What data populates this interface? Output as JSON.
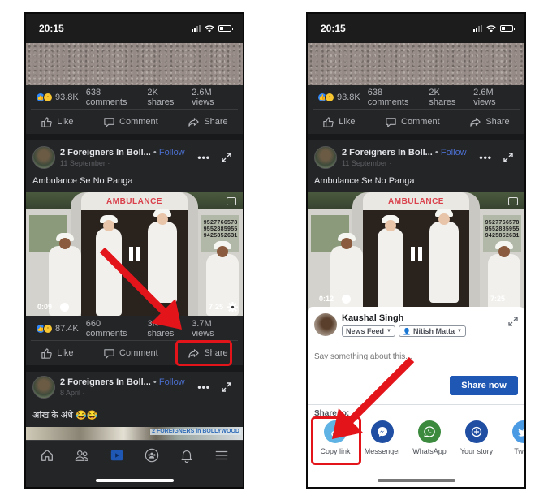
{
  "colors": {
    "accent_blue": "#1f57b4",
    "follow_blue": "#4b6fcf",
    "annotation_red": "#e3151b",
    "dark_bg": "#242526"
  },
  "left_phone": {
    "status": {
      "time": "20:15"
    },
    "top_post": {
      "reactions_count": "93.8K",
      "comments": "638 comments",
      "shares": "2K shares",
      "views": "2.6M views"
    },
    "actions": {
      "like": "Like",
      "comment": "Comment",
      "share": "Share"
    },
    "video_post": {
      "author": "2 Foreigners In Boll...",
      "follow": "Follow",
      "separator": "•",
      "date": "11 September ·",
      "caption": "Ambulance Se No Panga",
      "video_banner": "AMBULANCE",
      "door_phone_numbers": "9527766578\n9552885955\n9425852631",
      "elapsed": "0:09",
      "duration": "7:25",
      "reactions_count": "87.4K",
      "comments": "660 comments",
      "shares": "3K shares",
      "views": "3.7M views"
    },
    "next_post": {
      "author": "2 Foreigners In Boll...",
      "follow": "Follow",
      "separator": "•",
      "date": "8 April ·",
      "caption": "आंख के अंधे 😂😂",
      "thumb_badge": "2 FOREIGNERS in BOLLYWOOD"
    },
    "bottom_nav": [
      "home",
      "friends",
      "watch",
      "groups",
      "notifications",
      "menu"
    ],
    "active_nav": "watch",
    "annotation": "share-button-highlight"
  },
  "right_phone": {
    "status": {
      "time": "20:15"
    },
    "top_post": {
      "reactions_count": "93.8K",
      "comments": "638 comments",
      "shares": "2K shares",
      "views": "2.6M views"
    },
    "actions": {
      "like": "Like",
      "comment": "Comment",
      "share": "Share"
    },
    "video_post": {
      "author": "2 Foreigners In Boll...",
      "follow": "Follow",
      "separator": "•",
      "date": "11 September ·",
      "caption": "Ambulance Se No Panga",
      "video_banner": "AMBULANCE",
      "door_phone_numbers": "9527766578\n9552885955\n9425852631",
      "elapsed": "0:12",
      "duration": "7:25"
    },
    "share_sheet": {
      "user_name": "Kaushal Singh",
      "destination": "News Feed",
      "audience": "Nitish Matta",
      "input_placeholder": "Say something about this...",
      "share_now": "Share now",
      "share_to_label": "Share to:",
      "targets": [
        {
          "label": "Copy link",
          "icon": "link-icon",
          "color": "#5fb3e4"
        },
        {
          "label": "Messenger",
          "icon": "messenger-icon",
          "color": "#1f4ea3"
        },
        {
          "label": "WhatsApp",
          "icon": "whatsapp-icon",
          "color": "#3b8a3e"
        },
        {
          "label": "Your story",
          "icon": "plus-circle-icon",
          "color": "#1f4ea3"
        },
        {
          "label": "Twitte",
          "icon": "twitter-icon",
          "color": "#4a9be4"
        }
      ]
    },
    "annotation": "copy-link-highlight"
  }
}
